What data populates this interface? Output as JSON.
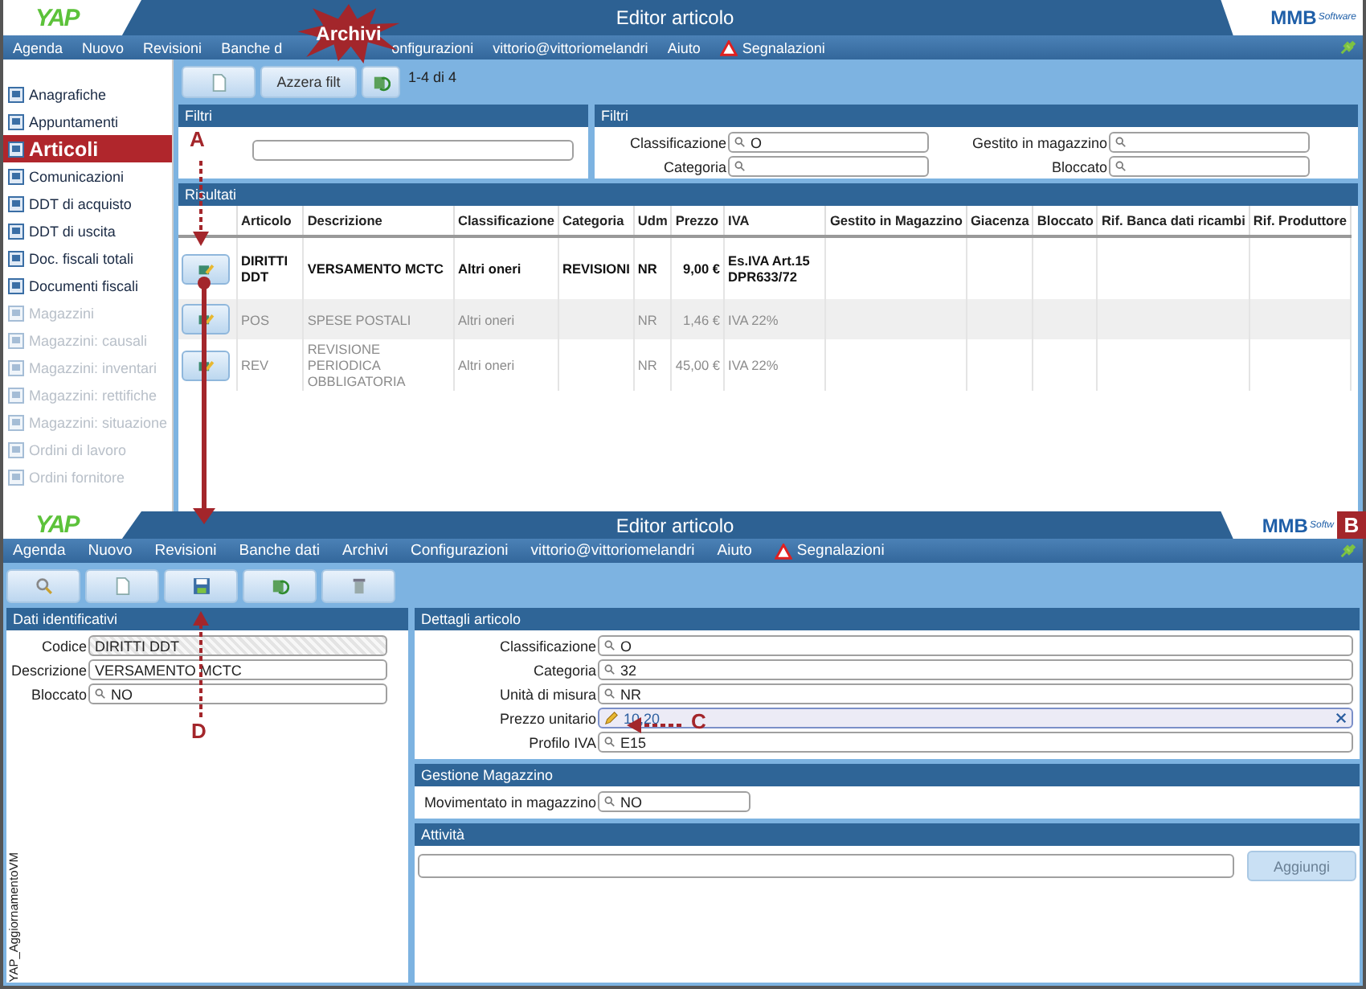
{
  "top_window": {
    "title_bar": {
      "logo": "YAP",
      "title": "Editor articolo",
      "brand": "MMB",
      "brand_sub": "Software"
    },
    "menu": [
      {
        "label": "Agenda",
        "kind": "plain"
      },
      {
        "label": "Nuovo",
        "kind": "plain"
      },
      {
        "label": "Revisioni",
        "kind": "plain"
      },
      {
        "label": "Banche d",
        "kind": "plain"
      },
      {
        "label": "onfigurazioni",
        "kind": "plain"
      },
      {
        "label": "vittorio@vittoriomelandri",
        "kind": "plain"
      },
      {
        "label": "Aiuto",
        "kind": "plain"
      },
      {
        "label": "Segnalazioni",
        "kind": "alert"
      }
    ],
    "sidebar": [
      {
        "label": "Anagrafiche",
        "selected": false,
        "disabled": false
      },
      {
        "label": "Appuntamenti",
        "selected": false,
        "disabled": false
      },
      {
        "label": "Articoli",
        "selected": true,
        "disabled": false
      },
      {
        "label": "Comunicazioni",
        "selected": false,
        "disabled": false
      },
      {
        "label": "DDT di acquisto",
        "selected": false,
        "disabled": false
      },
      {
        "label": "DDT di uscita",
        "selected": false,
        "disabled": false
      },
      {
        "label": "Doc. fiscali totali",
        "selected": false,
        "disabled": false
      },
      {
        "label": "Documenti fiscali",
        "selected": false,
        "disabled": false
      },
      {
        "label": "Magazzini",
        "selected": false,
        "disabled": true
      },
      {
        "label": "Magazzini: causali",
        "selected": false,
        "disabled": true
      },
      {
        "label": "Magazzini: inventari",
        "selected": false,
        "disabled": true
      },
      {
        "label": "Magazzini: rettifiche",
        "selected": false,
        "disabled": true
      },
      {
        "label": "Magazzini: situazione",
        "selected": false,
        "disabled": true
      },
      {
        "label": "Ordini di lavoro",
        "selected": false,
        "disabled": true
      },
      {
        "label": "Ordini fornitore",
        "selected": false,
        "disabled": true
      }
    ],
    "toolbar": {
      "buttons": [
        {
          "kind": "new"
        },
        {
          "kind": "text",
          "label": "Azzera filt"
        },
        {
          "kind": "refresh"
        }
      ],
      "count": "1-4 di 4"
    },
    "filters_left": {
      "title": "Filtri"
    },
    "filters_right": {
      "title": "Filtri",
      "fields": [
        {
          "label": "Classificazione",
          "value": "O"
        },
        {
          "label": "Gestito in magazzino"
        },
        {
          "label": "Categoria"
        },
        {
          "label": "Bloccato"
        }
      ]
    },
    "results": {
      "title": "Risultati",
      "columns": [
        "Articolo",
        "Descrizione",
        "Classificazione",
        "Categoria",
        "Udm",
        "Prezzo",
        "IVA",
        "Gestito in Magazzino",
        "Giacenza",
        "Bloccato",
        "Rif. Banca dati ricambi",
        "Rif. Produttore"
      ],
      "rows": [
        {
          "selected": true,
          "cells": [
            "DIRITTI DDT",
            "VERSAMENTO MCTC",
            "Altri oneri",
            "REVISIONI",
            "NR",
            "9,00 €",
            "Es.IVA Art.15 DPR633/72"
          ]
        },
        {
          "selected": false,
          "cells": [
            "POS",
            "SPESE POSTALI",
            "Altri oneri",
            "",
            "NR",
            "1,46 €",
            "IVA 22%"
          ]
        },
        {
          "selected": false,
          "cells": [
            "REV",
            "REVISIONE PERIODICA OBBLIGATORIA",
            "Altri oneri",
            "",
            "NR",
            "45,00 €",
            "IVA 22%"
          ]
        }
      ]
    }
  },
  "bottom_window": {
    "title_bar": {
      "logo": "YAP",
      "title": "Editor articolo",
      "brand": "MMB",
      "brand_sub": "Softw"
    },
    "menu": [
      {
        "label": "Agenda",
        "kind": "plain"
      },
      {
        "label": "Nuovo",
        "kind": "plain"
      },
      {
        "label": "Revisioni",
        "kind": "plain"
      },
      {
        "label": "Banche dati",
        "kind": "plain"
      },
      {
        "label": "Archivi",
        "kind": "plain"
      },
      {
        "label": "Configurazioni",
        "kind": "plain"
      },
      {
        "label": "vittorio@vittoriomelandri",
        "kind": "plain"
      },
      {
        "label": "Aiuto",
        "kind": "plain"
      },
      {
        "label": "Segnalazioni",
        "kind": "alert"
      }
    ],
    "toolbar": [
      {
        "kind": "search"
      },
      {
        "kind": "new"
      },
      {
        "kind": "save"
      },
      {
        "kind": "refresh"
      },
      {
        "kind": "delete"
      }
    ],
    "identity_panel": {
      "title": "Dati identificativi",
      "fields": [
        {
          "label": "Codice",
          "value": "DIRITTI DDT",
          "kind": "readonly"
        },
        {
          "label": "Descrizione",
          "value": "VERSAMENTO MCTC",
          "kind": "text"
        },
        {
          "label": "Bloccato",
          "value": "NO",
          "kind": "lookup"
        }
      ]
    },
    "details_panel": {
      "title": "Dettagli articolo",
      "fields": [
        {
          "label": "Classificazione",
          "value": "O",
          "kind": "lookup"
        },
        {
          "label": "Categoria",
          "value": "32",
          "kind": "lookup"
        },
        {
          "label": "Unità di misura",
          "value": "NR",
          "kind": "lookup"
        },
        {
          "label": "Prezzo unitario",
          "value": "10,20",
          "kind": "editing"
        },
        {
          "label": "Profilo IVA",
          "value": "E15",
          "kind": "lookup"
        }
      ]
    },
    "stock_panel": {
      "title": "Gestione Magazzino",
      "fields": [
        {
          "label": "Movimentato in magazzino",
          "value": "NO",
          "kind": "lookup"
        }
      ]
    },
    "activity_panel": {
      "title": "Attività",
      "button": {
        "label": "Aggiungi",
        "disabled": true
      }
    },
    "side_label": "YAP_AggiornamentoVM"
  },
  "annotations": [
    {
      "label": "Archivi",
      "kind": "burst"
    },
    {
      "label": "A",
      "kind": "letter"
    },
    {
      "label": "B",
      "kind": "box"
    },
    {
      "label": "C",
      "kind": "letter"
    },
    {
      "label": "D",
      "kind": "letter"
    }
  ]
}
